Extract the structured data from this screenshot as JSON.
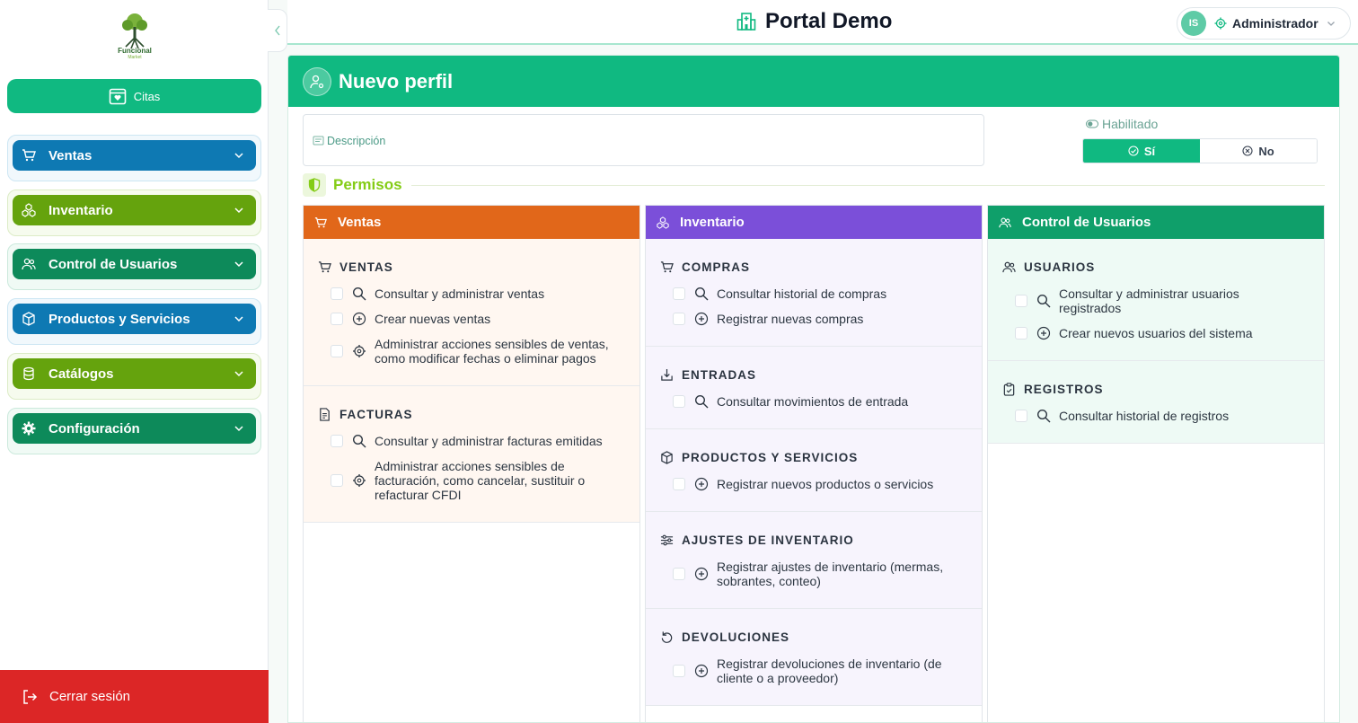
{
  "brand": {
    "name": "Funcional",
    "sub": "Market"
  },
  "sidebar": {
    "citas_label": "Citas",
    "items": [
      {
        "label": "Ventas",
        "icon": "cart-icon",
        "color": "#0e79b3"
      },
      {
        "label": "Inventario",
        "icon": "boxes-icon",
        "color": "#65a30d"
      },
      {
        "label": "Control de Usuarios",
        "icon": "users-icon",
        "color": "#0d8a5a"
      },
      {
        "label": "Productos y Servicios",
        "icon": "package-icon",
        "color": "#0e79b3"
      },
      {
        "label": "Catálogos",
        "icon": "database-icon",
        "color": "#65a30d"
      },
      {
        "label": "Configuración",
        "icon": "gear-icon",
        "color": "#0d8a5a"
      }
    ],
    "logout_label": "Cerrar sesión"
  },
  "topbar": {
    "title": "Portal Demo",
    "user_initials": "IS",
    "user_role": "Administrador"
  },
  "form": {
    "title": "Nuevo perfil",
    "description_placeholder": "Descripción",
    "enabled_label": "Habilitado",
    "yes_label": "Sí",
    "no_label": "No",
    "permissions_title": "Permisos"
  },
  "columns": [
    {
      "title": "Ventas",
      "color": "#e1671a",
      "sections": [
        {
          "title": "VENTAS",
          "permissions": [
            "Consultar y administrar ventas",
            "Crear nuevas ventas",
            "Administrar acciones sensibles de ventas, como modificar fechas o eliminar pagos"
          ]
        },
        {
          "title": "FACTURAS",
          "permissions": [
            "Consultar y administrar facturas emitidas",
            "Administrar acciones sensibles de facturación, como cancelar, sustituir o refacturar CFDI"
          ]
        }
      ]
    },
    {
      "title": "Inventario",
      "color": "#7b4fd9",
      "sections": [
        {
          "title": "COMPRAS",
          "permissions": [
            "Consultar historial de compras",
            "Registrar nuevas compras"
          ]
        },
        {
          "title": "ENTRADAS",
          "permissions": [
            "Consultar movimientos de entrada"
          ]
        },
        {
          "title": "PRODUCTOS Y SERVICIOS",
          "permissions": [
            "Registrar nuevos productos o servicios"
          ]
        },
        {
          "title": "AJUSTES DE INVENTARIO",
          "permissions": [
            "Registrar ajustes de inventario (mermas, sobrantes, conteo)"
          ]
        },
        {
          "title": "DEVOLUCIONES",
          "permissions": [
            "Registrar devoluciones de inventario (de cliente o a proveedor)"
          ]
        }
      ]
    },
    {
      "title": "Control de Usuarios",
      "color": "#0f9f6a",
      "sections": [
        {
          "title": "USUARIOS",
          "permissions": [
            "Consultar y administrar usuarios registrados",
            "Crear nuevos usuarios del sistema"
          ]
        },
        {
          "title": "REGISTROS",
          "permissions": [
            "Consultar historial de registros"
          ]
        }
      ]
    }
  ]
}
